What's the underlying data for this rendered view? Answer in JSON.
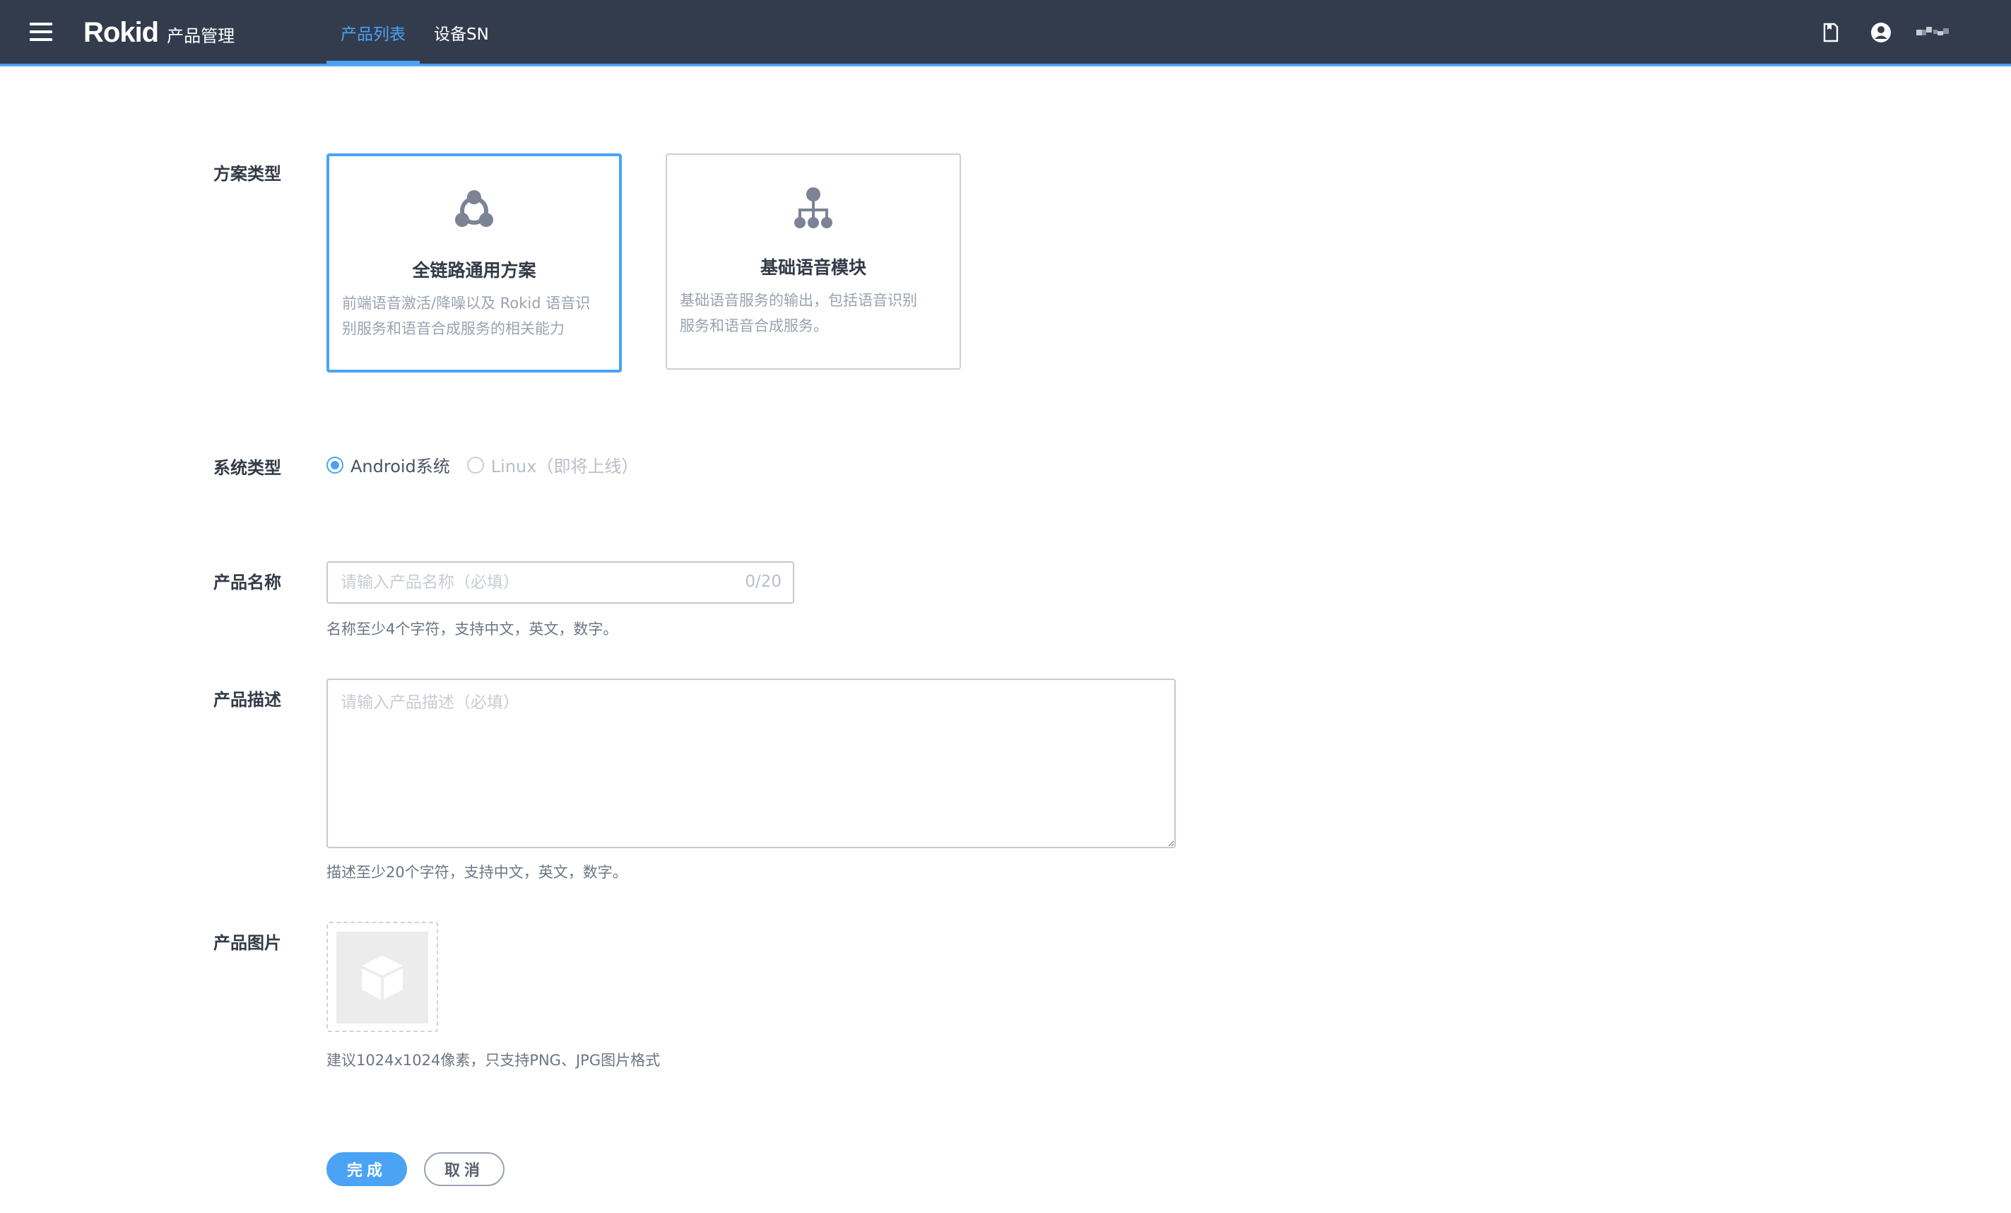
{
  "header": {
    "logo": "Rokid",
    "subtitle": "产品管理",
    "tabs": [
      {
        "label": "产品列表",
        "active": true
      },
      {
        "label": "设备SN",
        "active": false
      }
    ],
    "icons": [
      "document-icon",
      "user-avatar-icon",
      "username-pixel-icon"
    ]
  },
  "form": {
    "solution_label": "方案类型",
    "solutions": [
      {
        "title": "全链路通用方案",
        "desc_line1": "前端语音激活/降噪以及 Rokid 语音识",
        "desc_line2": "别服务和语音合成服务的相关能力",
        "selected": true,
        "icon": "network-nodes-icon"
      },
      {
        "title": "基础语音模块",
        "desc_line1": "基础语音服务的输出，包括语音识别",
        "desc_line2": "服务和语音合成服务。",
        "selected": false,
        "icon": "hierarchy-icon"
      }
    ],
    "system_label": "系统类型",
    "systems": [
      {
        "label": "Android系统",
        "checked": true,
        "disabled": false
      },
      {
        "label": "Linux（即将上线）",
        "checked": false,
        "disabled": true
      }
    ],
    "name_label": "产品名称",
    "name_placeholder": "请输入产品名称（必填）",
    "name_counter": "0/20",
    "name_hint": "名称至少4个字符，支持中文，英文，数字。",
    "desc_label": "产品描述",
    "desc_placeholder": "请输入产品描述（必填）",
    "desc_hint": "描述至少20个字符，支持中文，英文，数字。",
    "image_label": "产品图片",
    "image_hint": "建议1024x1024像素，只支持PNG、JPG图片格式",
    "submit_label": "完成",
    "cancel_label": "取消"
  },
  "colors": {
    "header_bg": "#333c4d",
    "accent": "#4aa3f5",
    "label_text": "#333a47",
    "muted_text": "#9aa3b0"
  }
}
